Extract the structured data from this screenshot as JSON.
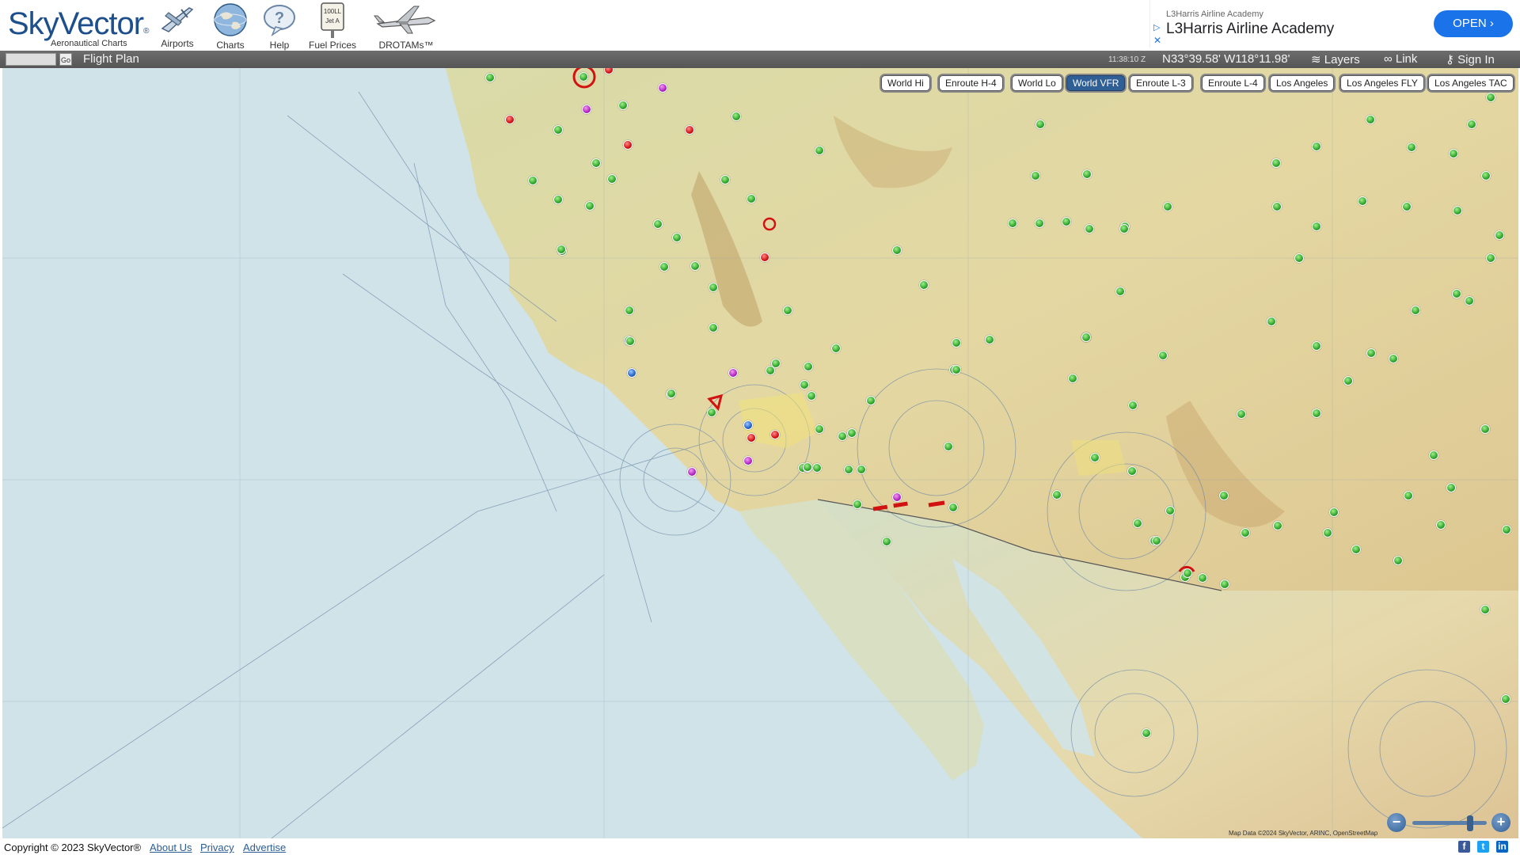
{
  "brand": {
    "name": "SkyVector",
    "registered": "®",
    "tagline": "Aeronautical Charts"
  },
  "nav": [
    {
      "label": "Airports",
      "icon": "airplane-icon"
    },
    {
      "label": "Charts",
      "icon": "globe-icon"
    },
    {
      "label": "Help",
      "icon": "help-bubble-icon"
    },
    {
      "label": "Fuel Prices",
      "icon": "fuel-sign-icon",
      "sign_text": "100LL Jet A"
    },
    {
      "label": "DROTAMs™",
      "icon": "drone-icon"
    }
  ],
  "ad": {
    "sponsor": "L3Harris Airline Academy",
    "headline": "L3Harris Airline Academy",
    "cta": "OPEN",
    "cta_icon": "chevron-right-icon",
    "adchoices_icon": "adchoices-icon",
    "close_icon": "close-icon"
  },
  "toolbar": {
    "go_label": "Go",
    "flight_plan_label": "Flight Plan",
    "clock": "11:38:10 Z",
    "coordinates": "N33°39.58' W118°11.98'",
    "layers_label": "Layers",
    "link_label": "Link",
    "signin_label": "Sign In"
  },
  "charts": {
    "active": "World VFR",
    "buttons": [
      "World Hi",
      "Enroute H-4",
      "World Lo",
      "World VFR",
      "Enroute L-3",
      "Enroute L-4",
      "Los Angeles",
      "Los Angeles FLY",
      "Los Angeles TAC"
    ]
  },
  "map": {
    "attribution": "Map Data ©2024 SkyVector, ARINC, OpenStreetMap",
    "colors": {
      "ocean": "#cfe3e8",
      "land_us": "#e3d9a6",
      "land_mexico": "#e8dcb3",
      "airport_towered": "#2fa52a",
      "restricted": "#d21111",
      "special": "#b124c0",
      "class_b": "#2362c4"
    }
  },
  "zoom": {
    "out_label": "−",
    "in_label": "+",
    "level": 0.8
  },
  "footer": {
    "copyright": "Copyright © 2023 SkyVector®",
    "links": [
      "About Us",
      "Privacy",
      "Advertise"
    ],
    "social": [
      {
        "name": "facebook-icon",
        "glyph": "f",
        "color": "#3b5998"
      },
      {
        "name": "twitter-icon",
        "glyph": "t",
        "color": "#1da1f2"
      },
      {
        "name": "linkedin-icon",
        "glyph": "in",
        "color": "#0a66c2"
      }
    ]
  }
}
